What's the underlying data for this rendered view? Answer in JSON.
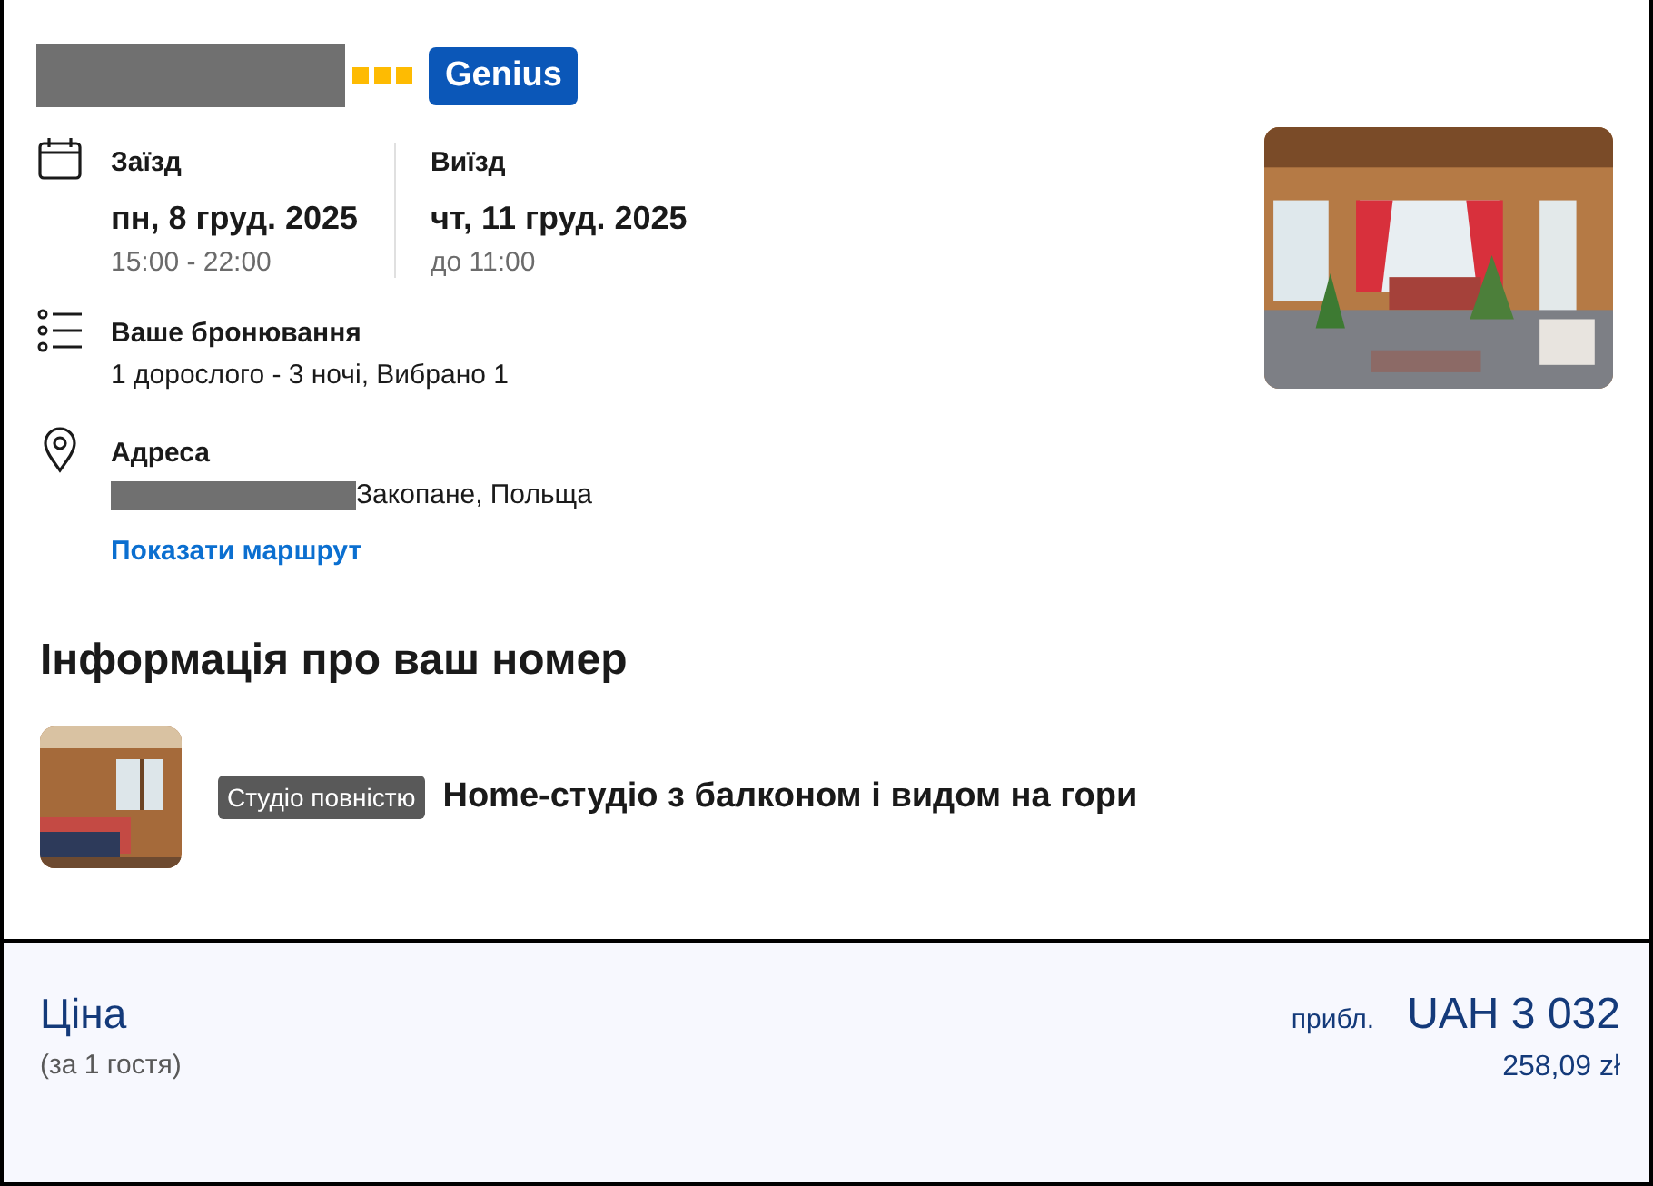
{
  "hotel": {
    "redacted": true,
    "stars": 3,
    "badge": "Genius"
  },
  "checkin": {
    "label": "Заїзд",
    "date": "пн, 8 груд. 2025",
    "time": "15:00 - 22:00"
  },
  "checkout": {
    "label": "Виїзд",
    "date": "чт, 11 груд. 2025",
    "time": "до 11:00"
  },
  "booking": {
    "label": "Ваше бронювання",
    "value": "1 дорослого - 3 ночі, Вибрано 1"
  },
  "address": {
    "label": "Адреса",
    "redacted": true,
    "value": "Закопане, Польща",
    "link": "Показати маршрут"
  },
  "room_section": {
    "title": "Інформація про ваш номер",
    "tag": "Студіо повністю",
    "name": "Home-студіо з балконом і видом на гори"
  },
  "price": {
    "label": "Ціна",
    "note": "(за 1 гостя)",
    "approx": "прибл.",
    "amount": "UAH 3 032",
    "local": "258,09 zł"
  }
}
